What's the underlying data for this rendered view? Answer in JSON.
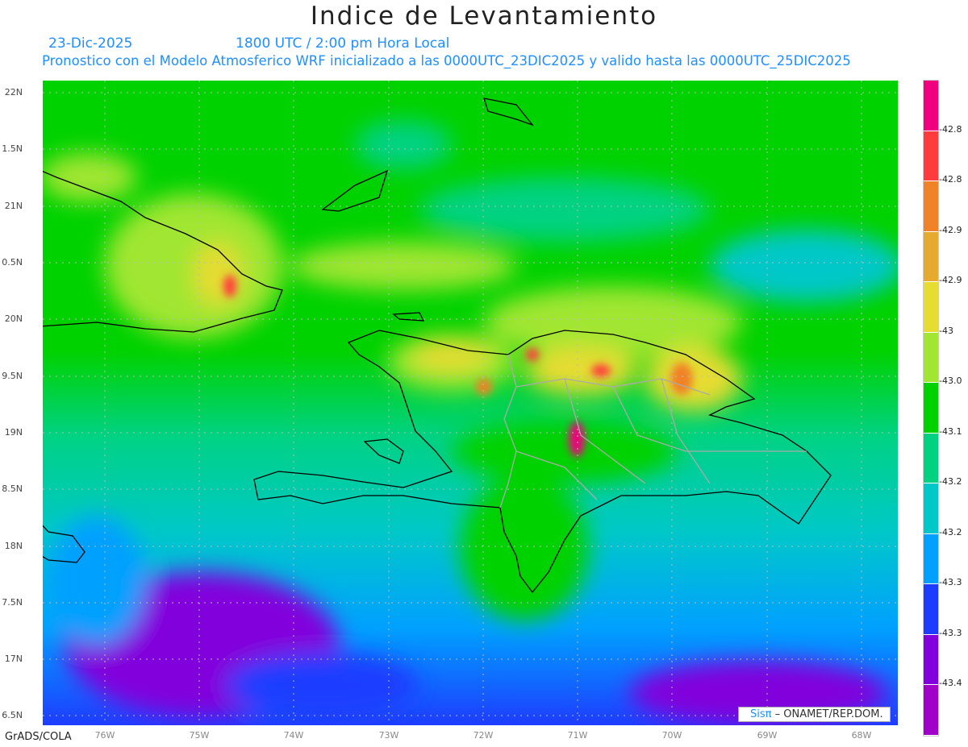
{
  "title": "Indice de Levantamiento",
  "date": "23-Dic-2025",
  "time": "1800 UTC / 2:00 pm Hora Local",
  "subtitle": "Pronostico con el Modelo Atmosferico WRF inicializado a las 0000UTC_23DIC2025 y valido hasta las  0000UTC_25DIC2025",
  "y_labels": [
    "22N",
    "1.5N",
    "21N",
    "0.5N",
    "20N",
    "9.5N",
    "19N",
    "8.5N",
    "18N",
    "7.5N",
    "17N",
    "6.5N"
  ],
  "x_labels": [
    "76W",
    "75W",
    "74W",
    "73W",
    "72W",
    "71W",
    "70W",
    "69W",
    "68W"
  ],
  "colorbar": {
    "colors": [
      "#f0007f",
      "#ff3c3c",
      "#f08228",
      "#e6aa2e",
      "#e6dc32",
      "#a0e632",
      "#00d200",
      "#00d282",
      "#00c8c8",
      "#00a0ff",
      "#1e3cff",
      "#8200dc",
      "#a000c8"
    ],
    "labels": [
      "-42.8",
      "-42.8",
      "-42.9",
      "-42.9",
      "-43",
      "-43.0",
      "-43.1",
      "-43.2",
      "-43.2",
      "-43.3",
      "-43.3",
      "-43.4"
    ]
  },
  "credit": {
    "brand": "Sisπ",
    "text": " – ONAMET/REP.DOM."
  },
  "footer": "GrADS/COLA"
}
